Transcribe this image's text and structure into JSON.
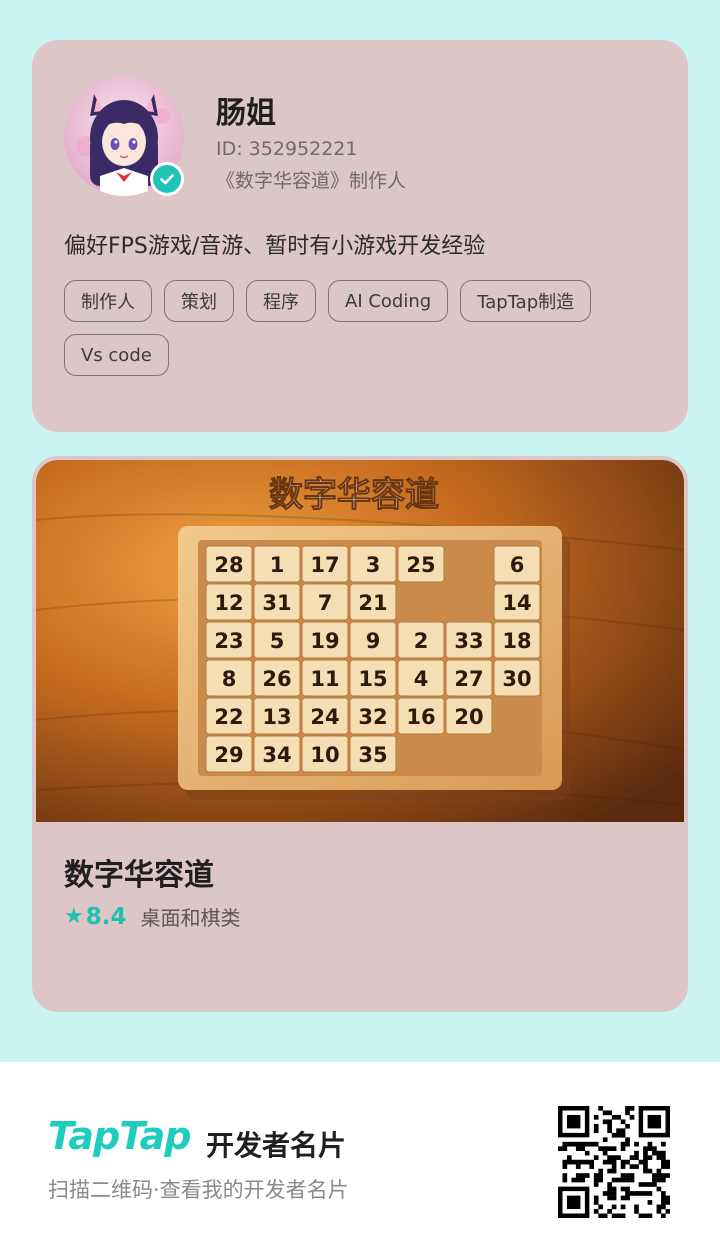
{
  "profile": {
    "name": "肠姐",
    "id_text": "ID: 352952221",
    "role": "《数字华容道》制作人",
    "bio": "偏好FPS游戏/音游、暂时有小游戏开发经验",
    "tags": [
      "制作人",
      "策划",
      "程序",
      "AI Coding",
      "TapTap制造",
      "Vs code"
    ],
    "verified_icon": "check-icon",
    "avatar_icon": "anime-avatar-icon"
  },
  "game": {
    "cover_title": "数字华容道",
    "title": "数字华容道",
    "rating": "8.4",
    "rating_icon": "star-icon",
    "category": "桌面和棋类",
    "tiles": [
      [
        "28",
        "1",
        "17",
        "3",
        "25",
        "",
        "6"
      ],
      [
        "12",
        "31",
        "7",
        "21",
        "",
        "",
        "14"
      ],
      [
        "23",
        "5",
        "19",
        "9",
        "2",
        "33",
        "18"
      ],
      [
        "8",
        "26",
        "11",
        "15",
        "4",
        "27",
        "30"
      ],
      [
        "22",
        "13",
        "24",
        "32",
        "16",
        "20",
        ""
      ],
      [
        "29",
        "34",
        "10",
        "35",
        "",
        "",
        ""
      ]
    ]
  },
  "footer": {
    "brand": "TapTap",
    "brand_suffix": "开发者名片",
    "hint": "扫描二维码·查看我的开发者名片",
    "qr_icon": "qr-code-icon"
  },
  "colors": {
    "background": "#c9f4ef",
    "card": "#ddc6c7",
    "accent": "#1fc4b6"
  }
}
